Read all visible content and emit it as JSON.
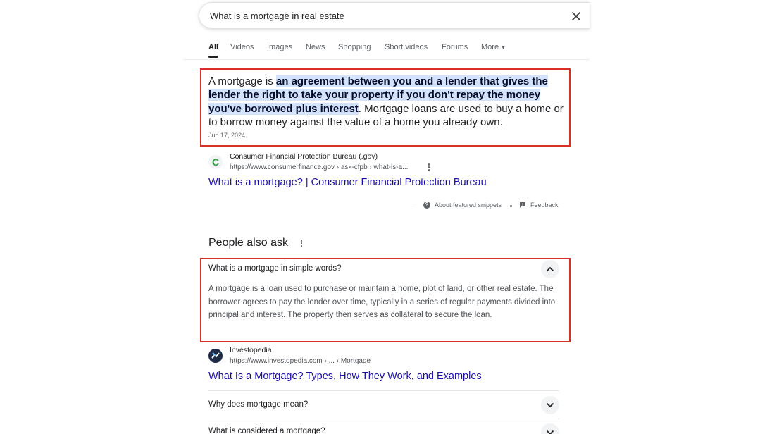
{
  "search": {
    "query": "What is a mortgage in real estate"
  },
  "tabs": [
    "All",
    "Videos",
    "Images",
    "News",
    "Shopping",
    "Short videos",
    "Forums",
    "More"
  ],
  "featured_snippet": {
    "text_before": "A mortgage is ",
    "highlight": "an agreement between you and a lender that gives the lender the right to take your property if you don't repay the money you've borrowed plus interest",
    "text_after": ". Mortgage loans are used to buy a home or to borrow money against the value of a home you already own.",
    "date": "Jun 17, 2024",
    "source": {
      "name": "Consumer Financial Protection Bureau (.gov)",
      "url": "https://www.consumerfinance.gov › ask-cfpb › what-is-a...",
      "link_title": "What is a mortgage? | Consumer Financial Protection Bureau",
      "icon_letter": "C",
      "icon_color": "#2e9e3e"
    },
    "about_label": "About featured snippets",
    "feedback_label": "Feedback"
  },
  "people_also_ask": {
    "title": "People also ask",
    "questions": [
      {
        "question": "What is a mortgage in simple words?",
        "expanded": true,
        "answer": "A mortgage is a loan used to purchase or maintain a home, plot of land, or other real estate. The borrower agrees to pay the lender over time, typically in a series of regular payments divided into principal and interest. The property then serves as collateral to secure the loan.",
        "source": {
          "name": "Investopedia",
          "url": "https://www.investopedia.com › ... › Mortgage",
          "link_title": "What Is a Mortgage? Types, How They Work, and Examples"
        }
      },
      {
        "question": "Why does mortgage mean?",
        "expanded": false
      },
      {
        "question": "What is considered a mortgage?",
        "expanded": false
      }
    ]
  },
  "colors": {
    "link": "#1a0dab",
    "highlight": "#d3e3fd",
    "annotation_box": "#d93025"
  }
}
